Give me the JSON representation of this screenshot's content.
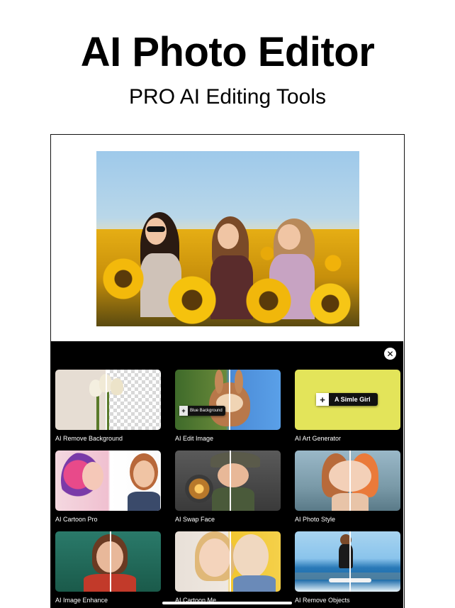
{
  "headline": "AI Photo Editor",
  "subheadline": "PRO AI Editing Tools",
  "preview": {
    "icon": "sunflower-field-photo"
  },
  "panel": {
    "close_icon": "close-icon",
    "close_glyph": "✕"
  },
  "tools": [
    {
      "label": "AI Remove Background",
      "icon": "remove-background-thumbnail"
    },
    {
      "label": "AI Edit Image",
      "icon": "edit-image-thumbnail",
      "badge": "Blue Background",
      "badge_plus": "+"
    },
    {
      "label": "AI Art Generator",
      "icon": "art-generator-thumbnail",
      "badge": "A Simle Girl",
      "badge_plus": "+"
    },
    {
      "label": "AI Cartoon Pro",
      "icon": "cartoon-pro-thumbnail"
    },
    {
      "label": "AI Swap Face",
      "icon": "swap-face-thumbnail"
    },
    {
      "label": "AI Photo Style",
      "icon": "photo-style-thumbnail"
    },
    {
      "label": "AI Image Enhance",
      "icon": "image-enhance-thumbnail"
    },
    {
      "label": "AI Cartoon Me",
      "icon": "cartoon-me-thumbnail"
    },
    {
      "label": "AI Remove Objects",
      "icon": "remove-objects-thumbnail"
    }
  ],
  "colors": {
    "panel_bg": "#000000",
    "art_generator_bg": "#e3e45a",
    "page_bg": "#ffffff"
  }
}
